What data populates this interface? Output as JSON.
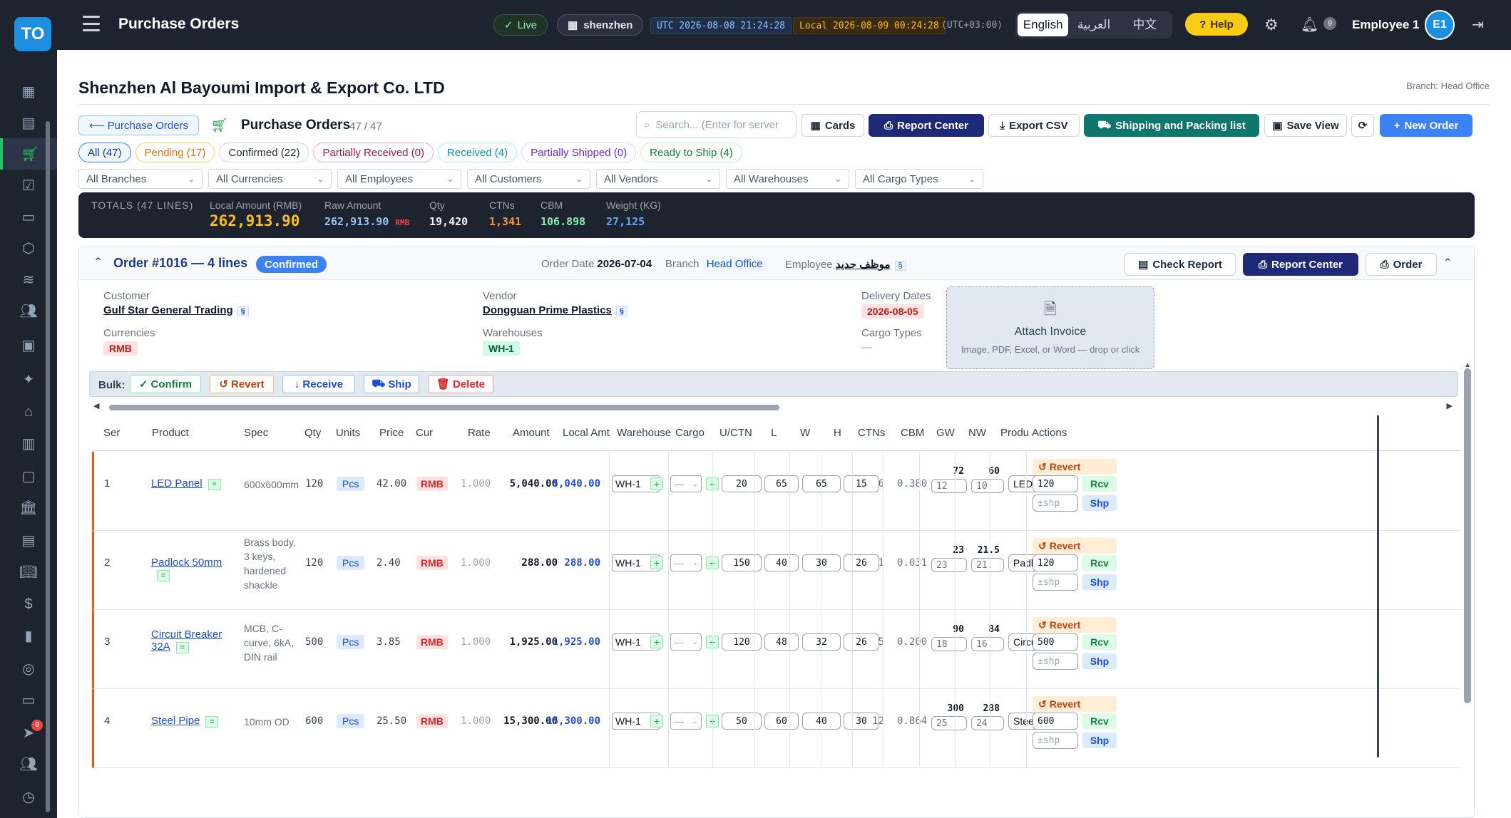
{
  "app": {
    "logo": "TO",
    "title": "Purchase Orders",
    "live": "Live",
    "branch": "shenzhen",
    "utc": "UTC 2026-08-08 21:24:28",
    "local": "Local 2026-08-09 00:24:28",
    "tz": "(UTC+03:00)",
    "languages": [
      "English",
      "العربية",
      "中文"
    ],
    "help": "Help",
    "notifications": "9",
    "user": "Employee 1",
    "avatar": "E1"
  },
  "sidebar": {
    "icons": [
      "dashboard-icon",
      "clipboard-icon",
      "cart-icon",
      "checklist-icon",
      "archive-icon",
      "box-icon",
      "layers-icon",
      "users-icon",
      "id-badge-icon",
      "person-icon",
      "bank-icon",
      "invoice-icon",
      "wallet-icon",
      "building-icon",
      "document-icon",
      "book-icon",
      "dollar-icon",
      "chart-icon",
      "lifebuoy-icon",
      "inbox-icon",
      "send-icon",
      "team-icon",
      "clock-icon"
    ],
    "badge": "9"
  },
  "page": {
    "company": "Shenzhen Al Bayoumi Import & Export Co. LTD",
    "branch_label": "Branch: Head Office",
    "back": "⟵ Purchase Orders",
    "title": "Purchase Orders",
    "count": "47 / 47",
    "search_placeholder": "Search... (Enter for server",
    "buttons": {
      "cards": "Cards",
      "report_center": "Report Center",
      "export_csv": "Export CSV",
      "shipping": "Shipping and Packing list",
      "save_view": "Save View",
      "new_order": "New Order"
    },
    "status_tabs": [
      "All (47)",
      "Pending (17)",
      "Confirmed (22)",
      "Partially Received (0)",
      "Received (4)",
      "Partially Shipped (0)",
      "Ready to Ship (4)"
    ],
    "filters": [
      "All Branches",
      "All Currencies",
      "All Employees",
      "All Customers",
      "All Vendors",
      "All Warehouses",
      "All Cargo Types"
    ]
  },
  "totals": {
    "label": "TOTALS (47 LINES)",
    "local_amount_label": "Local Amount (RMB)",
    "local_amount": "262,913.90",
    "raw_amount_label": "Raw Amount",
    "raw_amount": "262,913.90",
    "raw_cur": "RMB",
    "qty_label": "Qty",
    "qty": "19,420",
    "ctns_label": "CTNs",
    "ctns": "1,341",
    "cbm_label": "CBM",
    "cbm": "106.898",
    "weight_label": "Weight (KG)",
    "weight": "27,125"
  },
  "order": {
    "title": "Order #1016 — 4 lines",
    "status": "Confirmed",
    "order_date_label": "Order Date",
    "order_date": "2026-07-04",
    "branch_label": "Branch",
    "branch": "Head Office",
    "employee_label": "Employee",
    "employee": "موظف جديد",
    "check_report": "Check Report",
    "report_center": "Report Center",
    "order_btn": "Order",
    "customer_label": "Customer",
    "customer": "Gulf Star General Trading",
    "vendor_label": "Vendor",
    "vendor": "Dongguan Prime Plastics",
    "delivery_label": "Delivery Dates",
    "delivery": "2026-08-05",
    "currencies_label": "Currencies",
    "currency": "RMB",
    "warehouses_label": "Warehouses",
    "warehouse": "WH-1",
    "cargo_label": "Cargo Types",
    "cargo": "—",
    "attach_title": "Attach Invoice",
    "attach_sub": "Image, PDF, Excel, or Word — drop or click",
    "bulk_label": "Bulk:",
    "bulk": {
      "confirm": "Confirm",
      "revert": "Revert",
      "receive": "Receive",
      "ship": "Ship",
      "delete": "Delete"
    }
  },
  "table": {
    "headers": [
      "Ser",
      "Product",
      "Spec",
      "Qty",
      "Units",
      "Price",
      "Cur",
      "Rate",
      "Amount",
      "Local Amt",
      "Warehouse",
      "Cargo",
      "U/CTN",
      "L",
      "W",
      "H",
      "CTNs",
      "CBM",
      "GW",
      "NW",
      "Produ",
      "Actions"
    ],
    "rows": [
      {
        "ser": "1",
        "product": "LED Panel",
        "spec": [
          "600x600mm"
        ],
        "qty": "120",
        "unit": "Pcs",
        "price": "42.00",
        "cur": "RMB",
        "rate": "1.000",
        "amount": "5,040.00",
        "local": "5,040.00",
        "wh": "WH-1",
        "cargo": "—",
        "uctn": "20",
        "l": "65",
        "w": "65",
        "h": "15",
        "ctns": "6",
        "cbm": "0.380",
        "gw": "72",
        "gw_in": "12",
        "nw": "60",
        "nw_in": "10",
        "produ": "LED Pa",
        "rcv_qty": "120",
        "shp_ph": "±shp"
      },
      {
        "ser": "2",
        "product": "Padlock 50mm",
        "spec": [
          "Brass body,",
          "3 keys,",
          "hardened",
          "shackle"
        ],
        "qty": "120",
        "unit": "Pcs",
        "price": "2.40",
        "cur": "RMB",
        "rate": "1.000",
        "amount": "288.00",
        "local": "288.00",
        "wh": "WH-1",
        "cargo": "—",
        "uctn": "150",
        "l": "40",
        "w": "30",
        "h": "26",
        "ctns": "1",
        "cbm": "0.031",
        "gw": "23",
        "gw_in": "23",
        "nw": "21.5",
        "nw_in": "21.",
        "produ": "Padlock",
        "rcv_qty": "120",
        "shp_ph": "±shp"
      },
      {
        "ser": "3",
        "product": "Circuit Breaker 32A",
        "spec": [
          "MCB, C-",
          "curve, 6kA,",
          "DIN rail"
        ],
        "qty": "500",
        "unit": "Pcs",
        "price": "3.85",
        "cur": "RMB",
        "rate": "1.000",
        "amount": "1,925.00",
        "local": "1,925.00",
        "wh": "WH-1",
        "cargo": "—",
        "uctn": "120",
        "l": "48",
        "w": "32",
        "h": "26",
        "ctns": "5",
        "cbm": "0.200",
        "gw": "90",
        "gw_in": "18",
        "nw": "84",
        "nw_in": "16.",
        "produ": "Circuit E",
        "rcv_qty": "500",
        "shp_ph": "±shp"
      },
      {
        "ser": "4",
        "product": "Steel Pipe",
        "spec": [
          "10mm OD"
        ],
        "qty": "600",
        "unit": "Pcs",
        "price": "25.50",
        "cur": "RMB",
        "rate": "1.000",
        "amount": "15,300.00",
        "local": "15,300.00",
        "wh": "WH-1",
        "cargo": "—",
        "uctn": "50",
        "l": "60",
        "w": "40",
        "h": "30",
        "ctns": "12",
        "cbm": "0.864",
        "gw": "300",
        "gw_in": "25",
        "nw": "288",
        "nw_in": "24",
        "produ": "Steel Pi",
        "rcv_qty": "600",
        "shp_ph": "±shp"
      }
    ],
    "actions": {
      "revert": "Revert",
      "rcv": "Rcv",
      "shp": "Shp"
    }
  }
}
